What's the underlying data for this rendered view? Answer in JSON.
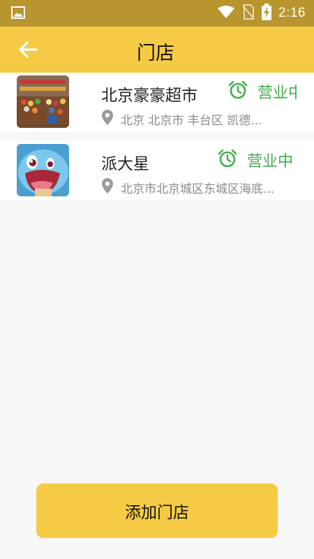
{
  "status_bar": {
    "time": "2:16",
    "icons": [
      "gallery-icon",
      "wifi-icon",
      "no-sim-icon",
      "battery-charging-icon"
    ]
  },
  "app_bar": {
    "back_icon": "arrow-left-icon",
    "title": "门店"
  },
  "stores": [
    {
      "name": "北京豪豪超市",
      "status": "营业中",
      "address": "北京 北京市 丰台区 凯德...",
      "thumb": "supermarket-photo"
    },
    {
      "name": "派大星",
      "status": "营业中",
      "address": "北京市北京城区东城区海底...",
      "thumb": "cartoon-photo"
    }
  ],
  "footer": {
    "add_label": "添加门店"
  },
  "colors": {
    "status_bar": "#b8952e",
    "accent": "#f5cb45",
    "open_green": "#3fae4a",
    "address_gray": "#8a8a8a"
  }
}
